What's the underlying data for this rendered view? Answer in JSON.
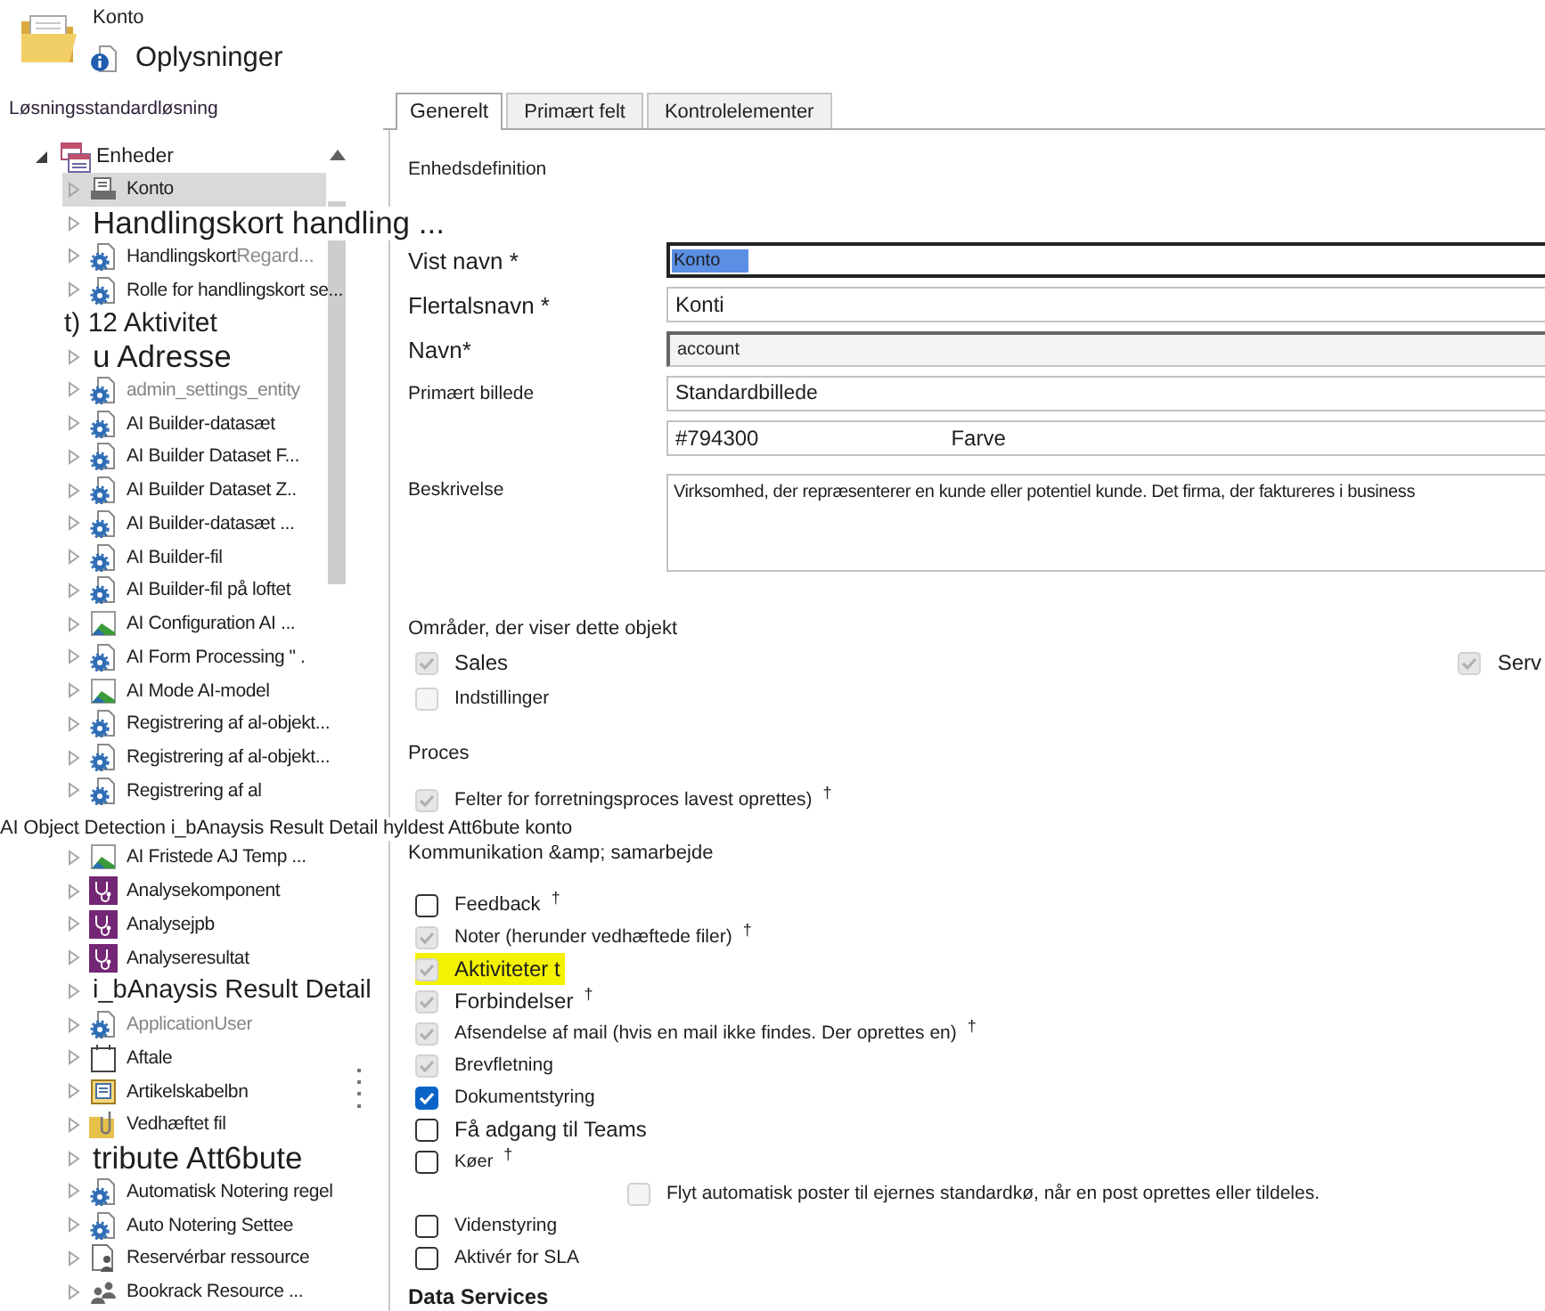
{
  "header": {
    "title": "Konto",
    "subtitle": "Oplysninger"
  },
  "tree": {
    "label": "Løsningsstandardløsning",
    "children": [
      {
        "label": "Enheder",
        "expanded": true,
        "selected": false,
        "children": [
          {
            "kind": "entity",
            "label": "Konto",
            "selected": true,
            "expanded": false,
            "dim": false
          },
          {
            "kind": "large",
            "label": "Handlingskort handling ...",
            "selected": false,
            "expanded": false
          },
          {
            "kind": "entity",
            "label": "Handlingskort",
            "faded": "Regard...",
            "selected": false,
            "expanded": false,
            "dim": false
          },
          {
            "kind": "entity",
            "label": "Rolle for handlingskort se...",
            "selected": false,
            "expanded": false,
            "dim": false
          },
          {
            "kind": "loose",
            "label": "t) 12 Aktivitet",
            "selected": false
          },
          {
            "kind": "large",
            "label": "u Adresse",
            "selected": false,
            "expanded": false
          },
          {
            "kind": "entity",
            "label": "admin_settings_entity",
            "selected": false,
            "expanded": false,
            "dim": true
          },
          {
            "kind": "entity",
            "label": "AI Builder-datasæt",
            "selected": false,
            "expanded": false,
            "dim": false
          },
          {
            "kind": "entity",
            "label": "AI Builder Dataset F...",
            "selected": false,
            "expanded": false,
            "dim": false
          },
          {
            "kind": "entity",
            "label": "AI Builder Dataset Z..",
            "selected": false,
            "expanded": false,
            "dim": false
          },
          {
            "kind": "entity",
            "label": "AI Builder-datasæt ...",
            "selected": false,
            "expanded": false,
            "dim": false
          },
          {
            "kind": "entity",
            "label": "AI Builder-fil",
            "selected": false,
            "expanded": false,
            "dim": false
          },
          {
            "kind": "entity",
            "label": "AI Builder-fil på loftet",
            "selected": false,
            "expanded": false,
            "dim": false
          },
          {
            "kind": "entity",
            "label": "AI Configuration AI ...",
            "selected": false,
            "expanded": false,
            "dim": false
          },
          {
            "kind": "entity",
            "label": "AI Form Processing \" .",
            "selected": false,
            "expanded": false,
            "dim": false
          },
          {
            "kind": "entity",
            "label": "AI Mode AI-model",
            "selected": false,
            "expanded": false,
            "dim": false
          },
          {
            "kind": "entity",
            "label": "Registrering af al-objekt...",
            "selected": false,
            "expanded": false,
            "dim": false
          },
          {
            "kind": "entity",
            "label": "Registrering af al-objekt...",
            "selected": false,
            "expanded": false,
            "dim": false
          },
          {
            "kind": "entity",
            "label": "Registrering af al",
            "selected": false,
            "expanded": false,
            "dim": false
          },
          {
            "kind": "spanning",
            "label": "AI Object Detection i_bAnaysis Result Detail hyldest Att6bute konto",
            "selected": false
          },
          {
            "kind": "entity",
            "label": "AI Fristede AJ Temp ...",
            "selected": false,
            "expanded": false,
            "dim": false
          },
          {
            "kind": "entity",
            "label": "Analysekomponent",
            "selected": false,
            "expanded": false,
            "dim": false
          },
          {
            "kind": "entity",
            "label": "Analysejpb",
            "selected": false,
            "expanded": false,
            "dim": false
          },
          {
            "kind": "entity",
            "label": "Analyseresultat",
            "selected": false,
            "expanded": false,
            "dim": false
          },
          {
            "kind": "medium",
            "label": "i_bAnaysis Result Detail",
            "selected": false,
            "expanded": false
          },
          {
            "kind": "entity",
            "label": "ApplicationUser",
            "selected": false,
            "expanded": false,
            "dim": true
          },
          {
            "kind": "entity",
            "label": "Aftale",
            "selected": false,
            "expanded": false,
            "dim": false
          },
          {
            "kind": "entity",
            "label": "Artikelskabelbn",
            "selected": false,
            "expanded": false,
            "dim": false
          },
          {
            "kind": "entity",
            "label": "Vedhæftet fil",
            "selected": false,
            "expanded": false,
            "dim": false
          },
          {
            "kind": "large",
            "label": "tribute Att6bute",
            "selected": false,
            "expanded": false
          },
          {
            "kind": "entity",
            "label": "Automatisk Notering regel",
            "selected": false,
            "expanded": false,
            "dim": false
          },
          {
            "kind": "entity",
            "label": "Auto Notering Settee",
            "selected": false,
            "expanded": false,
            "dim": false
          },
          {
            "kind": "entity",
            "label": "Reservérbar ressource",
            "selected": false,
            "expanded": false,
            "dim": false
          },
          {
            "kind": "entity",
            "label": "Bookrack Resource ...",
            "selected": false,
            "expanded": false,
            "dim": false
          }
        ]
      }
    ]
  },
  "tabs": [
    {
      "label": "Generelt",
      "selected": true
    },
    {
      "label": "Primært felt",
      "selected": false
    },
    {
      "label": "Kontrolelementer",
      "selected": false
    }
  ],
  "form": {
    "section": "Enhedsdefinition",
    "fields": [
      {
        "kind": "text",
        "label": "Vist navn *",
        "value": "Konto",
        "focused": true,
        "disabled": false
      },
      {
        "kind": "text",
        "label": "Flertalsnavn *",
        "value": "Konti",
        "focused": false,
        "disabled": false
      },
      {
        "kind": "text",
        "label": "Navn*",
        "value": "account",
        "focused": false,
        "disabled": true
      },
      {
        "kind": "text",
        "label": "Primært billede",
        "value": "Standardbillede",
        "focused": false,
        "disabled": false
      },
      {
        "kind": "color",
        "value": "#794300",
        "caption": "Farve"
      },
      {
        "kind": "textarea",
        "label": "Beskrivelse",
        "value": "Virksomhed, der repræsenterer en kunde eller potentiel kunde. Det firma, der faktureres i business"
      }
    ]
  },
  "areas": {
    "title": "Områder, der viser dette objekt",
    "options": [
      {
        "label": "Sales",
        "checked": true,
        "disabled": true
      },
      {
        "label": "Serv",
        "checked": true,
        "disabled": true
      },
      {
        "label": "Indstillinger",
        "checked": false,
        "disabled": true
      }
    ]
  },
  "process": {
    "title": "Proces",
    "options": [
      {
        "label": "Felter for forretningsproces lavest oprettes)",
        "note": "†",
        "checked": true,
        "disabled": true
      }
    ]
  },
  "communication": {
    "title": "Kommunikation &amp; samarbejde",
    "options": [
      {
        "label": "Feedback",
        "note": "†",
        "checked": false,
        "disabled": false,
        "highlighted": false
      },
      {
        "label": "Noter (herunder vedhæftede filer)",
        "note": "†",
        "checked": true,
        "disabled": true,
        "highlighted": false
      },
      {
        "label": "Aktiviteter t",
        "checked": true,
        "disabled": true,
        "highlighted": true
      },
      {
        "label": "Forbindelser",
        "note": "†",
        "checked": true,
        "disabled": true,
        "highlighted": false
      },
      {
        "label": "Afsendelse af mail (hvis en mail ikke findes. Der oprettes en)",
        "note": "†",
        "checked": true,
        "disabled": true,
        "highlighted": false
      },
      {
        "label": "Brevfletning",
        "checked": true,
        "disabled": true,
        "highlighted": false
      },
      {
        "label": "Dokumentstyring",
        "checked": true,
        "disabled": false,
        "highlighted": false
      },
      {
        "label": "Få adgang til Teams",
        "checked": false,
        "disabled": false,
        "highlighted": false
      },
      {
        "label": "Køer",
        "note": "†",
        "checked": false,
        "disabled": false,
        "highlighted": false,
        "children": [
          {
            "label": "Flyt automatisk poster til ejernes standardkø, når en post oprettes eller tildeles.",
            "checked": false,
            "disabled": true,
            "highlighted": false
          }
        ]
      },
      {
        "label": "Videnstyring",
        "checked": false,
        "disabled": false,
        "highlighted": false
      },
      {
        "label": "Aktivér for SLA",
        "checked": false,
        "disabled": false,
        "highlighted": false
      }
    ]
  },
  "data_services": {
    "title": "Data Services"
  }
}
